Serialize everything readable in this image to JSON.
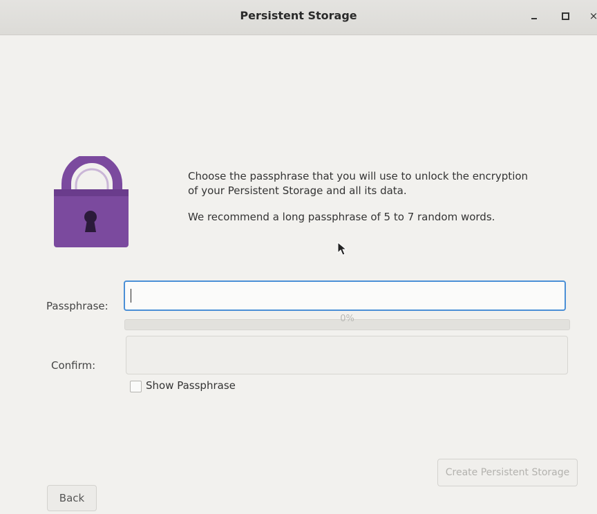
{
  "window": {
    "title": "Persistent Storage",
    "controls": {
      "minimize": "–",
      "maximize": "□",
      "close": "×"
    }
  },
  "intro": {
    "line1": "Choose the passphrase that you will use to unlock the encryption",
    "line2": "of your Persistent Storage and all its data.",
    "recommend": "We recommend a long passphrase of 5 to 7 random words."
  },
  "form": {
    "passphrase_label": "Passphrase:",
    "passphrase_value": "",
    "strength_text": "0%",
    "strength_fraction": 0,
    "confirm_label": "Confirm:",
    "confirm_value": "",
    "show_passphrase_label": "Show Passphrase",
    "show_passphrase_checked": false
  },
  "buttons": {
    "create": "Create Persistent Storage",
    "back": "Back"
  },
  "colors": {
    "lock_purple": "#7b4a9e",
    "lock_dark": "#5e3680",
    "focus_blue": "#4a8fd6"
  },
  "icons": {
    "lock": "padlock-icon",
    "cursor": "mouse-pointer-icon"
  }
}
